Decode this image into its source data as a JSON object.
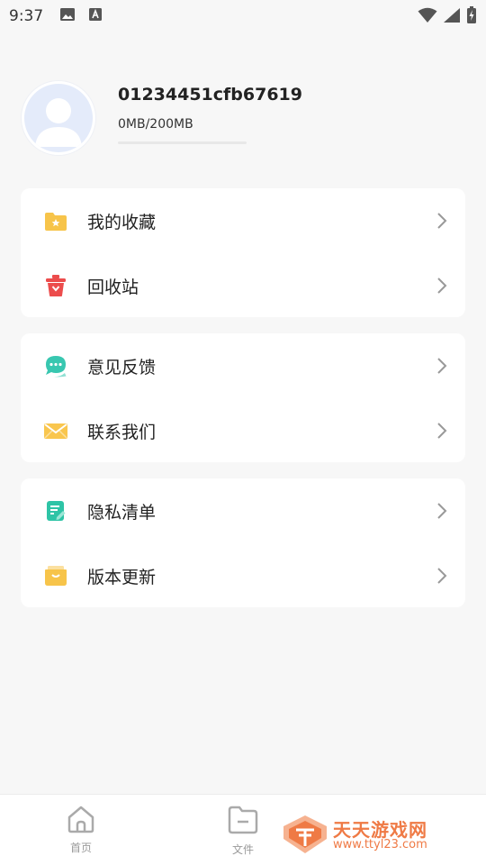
{
  "status_bar": {
    "time": "9:37"
  },
  "profile": {
    "user_id": "01234451cfb67619",
    "storage_text": "0MB/200MB",
    "storage_used_fraction": 0
  },
  "menu": {
    "group1": [
      {
        "label": "我的收藏",
        "icon": "favorites-folder-icon"
      },
      {
        "label": "回收站",
        "icon": "recycle-bin-icon"
      }
    ],
    "group2": [
      {
        "label": "意见反馈",
        "icon": "feedback-chat-icon"
      },
      {
        "label": "联系我们",
        "icon": "mail-envelope-icon"
      }
    ],
    "group3": [
      {
        "label": "隐私清单",
        "icon": "privacy-list-icon"
      },
      {
        "label": "版本更新",
        "icon": "version-update-icon"
      }
    ]
  },
  "tabbar": {
    "home_label": "首页",
    "files_label": "文件"
  },
  "watermark": {
    "title": "天天游戏网",
    "url": "www.ttyl23.com"
  },
  "colors": {
    "background": "#f7f7f7",
    "card": "#ffffff",
    "folder_yellow": "#f7c44a",
    "recycle_red": "#ec4c4c",
    "feedback_teal": "#38c7b0",
    "privacy_teal": "#2ec4a6",
    "watermark_orange": "#ef7a45"
  }
}
